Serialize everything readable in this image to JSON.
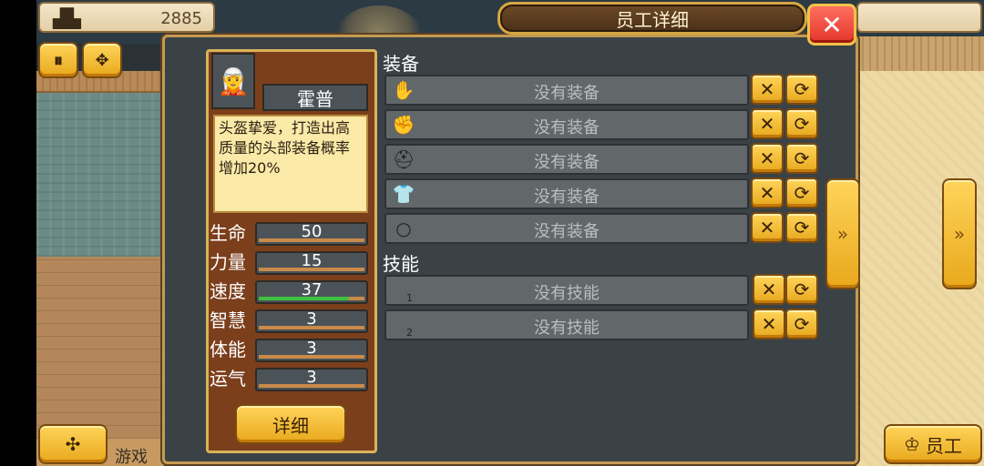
{
  "hud": {
    "coin_value": "2885",
    "right_staff_label": "员工",
    "game_label": "游戏"
  },
  "dialog": {
    "title": "员工详细",
    "close_symbol": "✕",
    "character": {
      "name": "霍普",
      "portrait": "🧝",
      "description": "头盔挚爱，打造出高质量的头部装备概率增加20%",
      "detail_button": "详细"
    },
    "stats": [
      {
        "label": "生命",
        "value": "50",
        "fill": 0
      },
      {
        "label": "力量",
        "value": "15",
        "fill": 0
      },
      {
        "label": "速度",
        "value": "37",
        "fill": 0.85
      },
      {
        "label": "智慧",
        "value": "3",
        "fill": 0
      },
      {
        "label": "体能",
        "value": "3",
        "fill": 0
      },
      {
        "label": "运气",
        "value": "3",
        "fill": 0
      }
    ],
    "equipment_title": "装备",
    "equipment": [
      {
        "icon": "glove-icon",
        "glyph": "✋",
        "text": "没有装备"
      },
      {
        "icon": "gauntlet-icon",
        "glyph": "✊",
        "text": "没有装备"
      },
      {
        "icon": "helmet-icon",
        "glyph": "⛑",
        "text": "没有装备"
      },
      {
        "icon": "armor-icon",
        "glyph": "👕",
        "text": "没有装备"
      },
      {
        "icon": "ring-icon",
        "glyph": "○",
        "text": "没有装备"
      }
    ],
    "skills_title": "技能",
    "skills": [
      {
        "num": "1",
        "text": "没有技能"
      },
      {
        "num": "2",
        "text": "没有技能"
      }
    ]
  },
  "colors": {
    "gold": "#e8a81c",
    "panel": "#3a4246",
    "char_panel": "#7c3f1c",
    "close_red": "#e2352a",
    "speed_green": "#3fc13f"
  }
}
